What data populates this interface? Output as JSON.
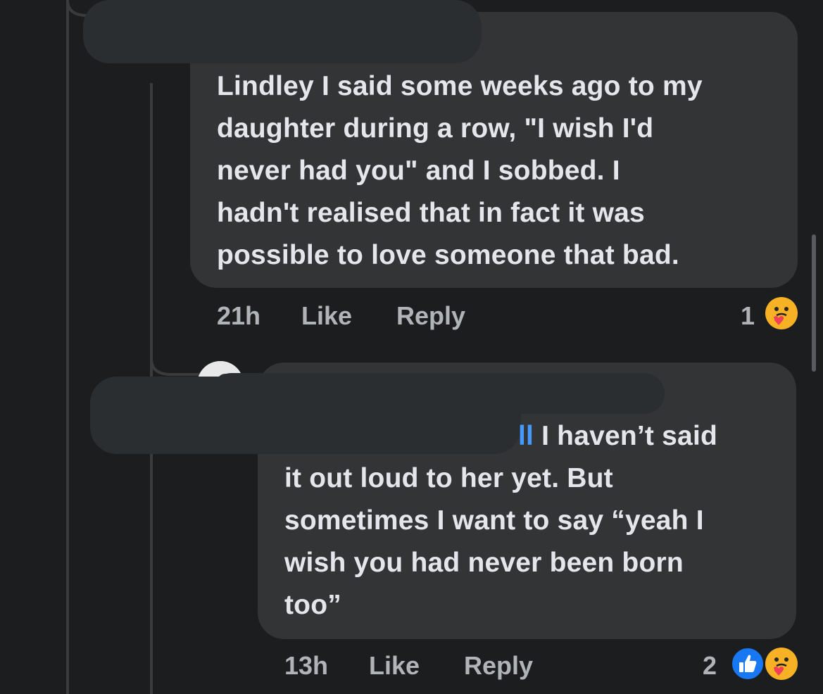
{
  "comments": [
    {
      "text": "Lindley I said some weeks ago to my daughter during a row, \"I wish I'd never had you\" and I sobbed. I hadn't realised that in fact it was possible to love someone that bad.",
      "lines": [
        "Lindley I said some weeks ago to my",
        "daughter during a row, \"I wish I'd",
        "never had you\" and I sobbed. I",
        "hadn't realised that in fact it was",
        "possible to love someone that bad."
      ],
      "time": "21h",
      "like_label": "Like",
      "reply_label": "Reply",
      "reaction_count": "1",
      "reactions": [
        "care-icon"
      ]
    },
    {
      "mention_fragment": "ll",
      "first_line_rest": " I haven’t said",
      "lines": [
        "it out loud to her yet. But",
        "sometimes I want to say “yeah I",
        "wish you had never been born",
        "too”"
      ],
      "time": "13h",
      "like_label": "Like",
      "reply_label": "Reply",
      "reaction_count": "2",
      "reactions": [
        "like-icon",
        "care-icon"
      ]
    }
  ],
  "colors": {
    "background": "#1c1d1f",
    "bubble": "#333436",
    "text": "#e4e6eb",
    "meta": "#b0b3b8",
    "mention": "#4599ff"
  }
}
